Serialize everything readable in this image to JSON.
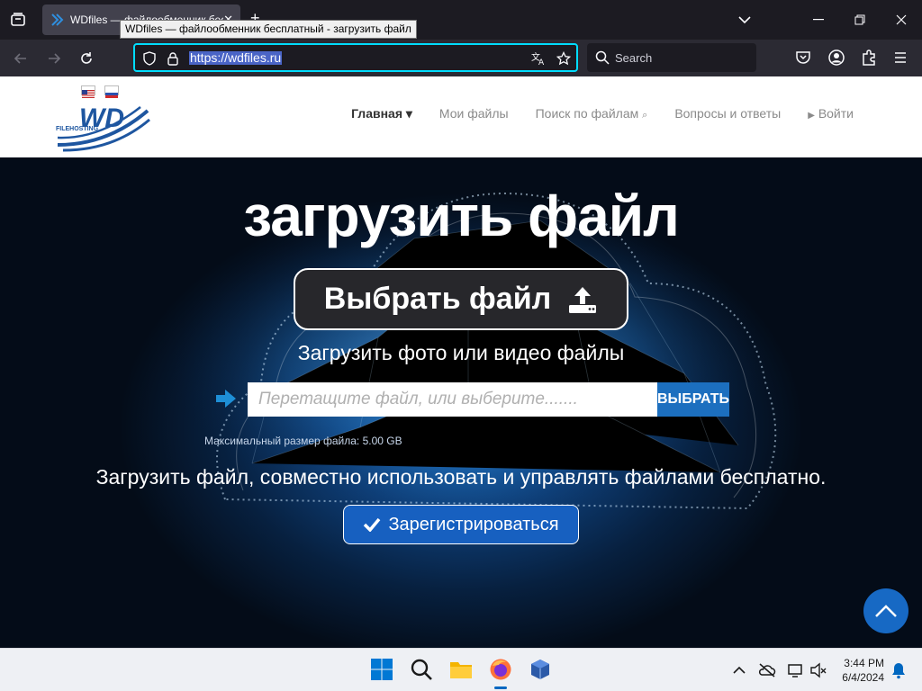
{
  "browser": {
    "tab_title": "WDfiles — файлообменник бесплатный - загрузить файл",
    "tooltip": "WDfiles — файлообменник бесплатный - загрузить файл",
    "url": "https://wdfiles.ru",
    "search_placeholder": "Search"
  },
  "site": {
    "logo_text": "WD",
    "logo_subtext": "FILEHOSTING",
    "menu": [
      {
        "label": "Главная ▾",
        "active": true
      },
      {
        "label": "Мои файлы",
        "active": false
      },
      {
        "label": "Поиск по файлам",
        "active": false
      },
      {
        "label": "Вопросы и ответы",
        "active": false
      },
      {
        "label": "Войти",
        "active": false
      }
    ]
  },
  "hero": {
    "title": "загрузить файл",
    "choose_button": "Выбрать файл",
    "subtitle": "Загрузить фото или видео файлы",
    "drop_placeholder": "Перетащите файл, или выберите.......",
    "pick_button": "ВЫБРАТЬ",
    "max_size": "Максимальный размер файла: 5.00 GB",
    "tagline": "Загрузить файл, совместно использовать и управлять файлами бесплатно.",
    "register_button": "Зарегистрироваться"
  },
  "taskbar": {
    "time": "3:44 PM",
    "date": "6/4/2024"
  },
  "colors": {
    "accent_url": "#00ddff",
    "brand_blue": "#1c6fbf",
    "chrome_dark": "#1c1b22"
  }
}
